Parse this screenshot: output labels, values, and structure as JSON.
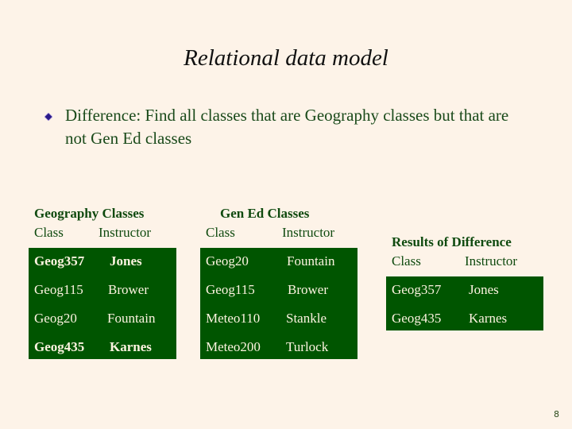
{
  "slide": {
    "title": "Relational data model",
    "bullet": {
      "icon": "diamond-bullet-icon",
      "text": "Difference: Find all classes that are Geography classes but that are not Gen Ed classes"
    },
    "page_number": "8"
  },
  "colors": {
    "background": "#fdf3e8",
    "table_fill": "#005500",
    "table_text": "#fdf3e0",
    "heading_text": "#0f4a0f",
    "bullet_icon": "#2a1a8a"
  },
  "tables": {
    "geography": {
      "title": "Geography Classes",
      "columns": [
        "Class",
        "Instructor"
      ],
      "rows": [
        {
          "class": "Geog357",
          "instructor": "Jones",
          "bold": true
        },
        {
          "class": "Geog115",
          "instructor": "Brower",
          "bold": false
        },
        {
          "class": "Geog20",
          "instructor": "Fountain",
          "bold": false
        },
        {
          "class": "Geog435",
          "instructor": "Karnes",
          "bold": true
        }
      ]
    },
    "gened": {
      "title": "Gen Ed Classes",
      "columns": [
        "Class",
        "Instructor"
      ],
      "rows": [
        {
          "class": "Geog20",
          "instructor": "Fountain"
        },
        {
          "class": "Geog115",
          "instructor": "Brower"
        },
        {
          "class": "Meteo110",
          "instructor": "Stankle"
        },
        {
          "class": "Meteo200",
          "instructor": "Turlock"
        }
      ]
    },
    "results": {
      "title": "Results of Difference",
      "columns": [
        "Class",
        "Instructor"
      ],
      "rows": [
        {
          "class": "Geog357",
          "instructor": "Jones"
        },
        {
          "class": "Geog435",
          "instructor": "Karnes"
        }
      ]
    }
  }
}
